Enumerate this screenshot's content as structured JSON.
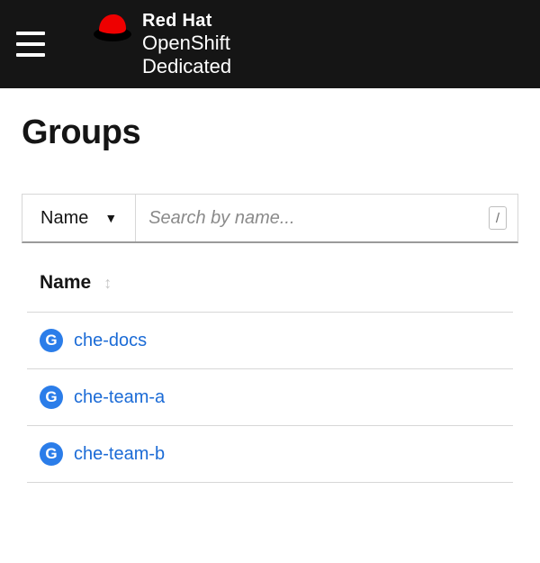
{
  "brand": {
    "line1": "Red Hat",
    "line2": "OpenShift",
    "line3": "Dedicated"
  },
  "page": {
    "title": "Groups"
  },
  "toolbar": {
    "filter_label": "Name",
    "search_placeholder": "Search by name...",
    "kbd_hint": "/"
  },
  "table": {
    "header": "Name",
    "group_icon_letter": "G",
    "rows": [
      {
        "name": "che-docs"
      },
      {
        "name": "che-team-a"
      },
      {
        "name": "che-team-b"
      }
    ]
  }
}
